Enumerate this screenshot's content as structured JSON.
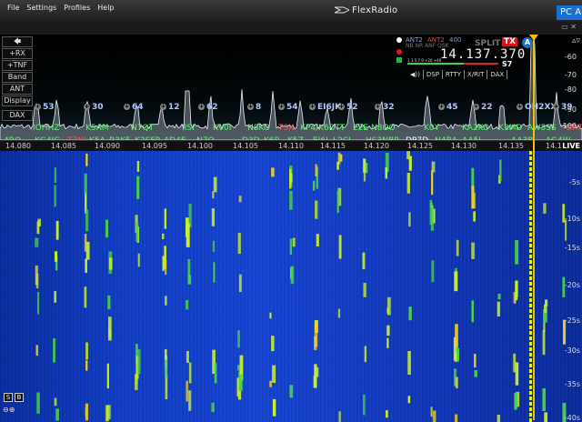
{
  "menubar": {
    "items": [
      "File",
      "Settings",
      "Profiles",
      "Help"
    ],
    "brand": "FlexRadio",
    "pc_button": "PC A"
  },
  "left_controls": [
    "+RX",
    "+TNF",
    "Band",
    "ANT",
    "Display",
    "DAX"
  ],
  "db_scale": [
    "-60",
    "-70",
    "-80",
    "-90",
    "-100",
    "-110"
  ],
  "scale_top_icon": "▵▿",
  "spot_numbers": [
    {
      "text": "53"
    },
    {
      "text": "30"
    },
    {
      "text": "64"
    },
    {
      "text": "12"
    },
    {
      "text": "62"
    },
    {
      "text": "8"
    },
    {
      "text": "54"
    },
    {
      "text": "EI6JK"
    },
    {
      "text": "52"
    },
    {
      "text": "32"
    },
    {
      "text": "45"
    },
    {
      "text": "22"
    },
    {
      "text": "OH2XX"
    },
    {
      "text": "39"
    }
  ],
  "spots_row1": [
    {
      "text": "IOHHZ",
      "color": "green"
    },
    {
      "text": "K5AM",
      "color": "green"
    },
    {
      "text": "N7QT",
      "color": "green"
    },
    {
      "text": "IISI",
      "color": "green"
    },
    {
      "text": "KV0I",
      "color": "green"
    },
    {
      "text": "N8KO",
      "color": "green"
    },
    {
      "text": "T3X",
      "color": "red"
    },
    {
      "text": "KP4/K6DTT",
      "color": "green"
    },
    {
      "text": "E2E",
      "color": "green"
    },
    {
      "text": "N8OO",
      "color": "green"
    },
    {
      "text": "K0Y",
      "color": "green"
    },
    {
      "text": "KA2KO",
      "color": "green"
    },
    {
      "text": "K3MD",
      "color": "green"
    },
    {
      "text": "AW5SS",
      "color": "green"
    },
    {
      "text": "OP7",
      "color": "red"
    }
  ],
  "spots_row2": [
    {
      "text": "4RO",
      "color": "green"
    },
    {
      "text": "KG4IG",
      "color": "green"
    },
    {
      "text": "T7NI",
      "color": "red"
    },
    {
      "text": "K5A",
      "color": "green"
    },
    {
      "text": "R3KF",
      "color": "green"
    },
    {
      "text": "K2SFP",
      "color": "green"
    },
    {
      "text": "AD4E",
      "color": "green"
    },
    {
      "text": "N7Q",
      "color": "green"
    },
    {
      "text": "D3D",
      "color": "green"
    },
    {
      "text": "K6P",
      "color": "green"
    },
    {
      "text": "K5Z",
      "color": "green"
    },
    {
      "text": "EI6J",
      "color": "green"
    },
    {
      "text": "L2CI",
      "color": "green"
    },
    {
      "text": "HS3NBR",
      "color": "green"
    },
    {
      "text": "DP7D",
      "color": "white"
    },
    {
      "text": "N4BA",
      "color": "green"
    },
    {
      "text": "AA5I",
      "color": "green"
    },
    {
      "text": "AA3B",
      "color": "green"
    },
    {
      "text": "AG4W",
      "color": "green"
    }
  ],
  "slice": {
    "ant_rx": "ANT2",
    "ant_tx": "ANT2",
    "bandwidth": "400",
    "flags": "NB NR ANF QSK",
    "split": "SPLIT",
    "tx": "TX",
    "letter": "A",
    "frequency": "14.137.370",
    "s_scale": "1  3  5  7  9  +20 +40",
    "s_value": "S7",
    "buttons": [
      "◀))",
      "DSP",
      "RTTY",
      "X/RIT",
      "DAX"
    ]
  },
  "freq_axis": {
    "ticks": [
      "14.080",
      "14.085",
      "14.090",
      "14.095",
      "14.100",
      "14.105",
      "14.110",
      "14.115",
      "14.120",
      "14.125",
      "14.130",
      "14.135",
      "14.1"
    ],
    "live": "LIVE"
  },
  "waterfall_times": [
    "-5s",
    "-10s",
    "-15s",
    "-20s",
    "-25s",
    "-30s",
    "-35s",
    "-40s"
  ],
  "waterfall_controls": [
    "S",
    "B"
  ],
  "colors": {
    "vfo": "#f3c000",
    "accent": "#1a6fd0",
    "tx_red": "#d01818",
    "spot_green": "#55ff66",
    "spot_red": "#ff5555"
  }
}
